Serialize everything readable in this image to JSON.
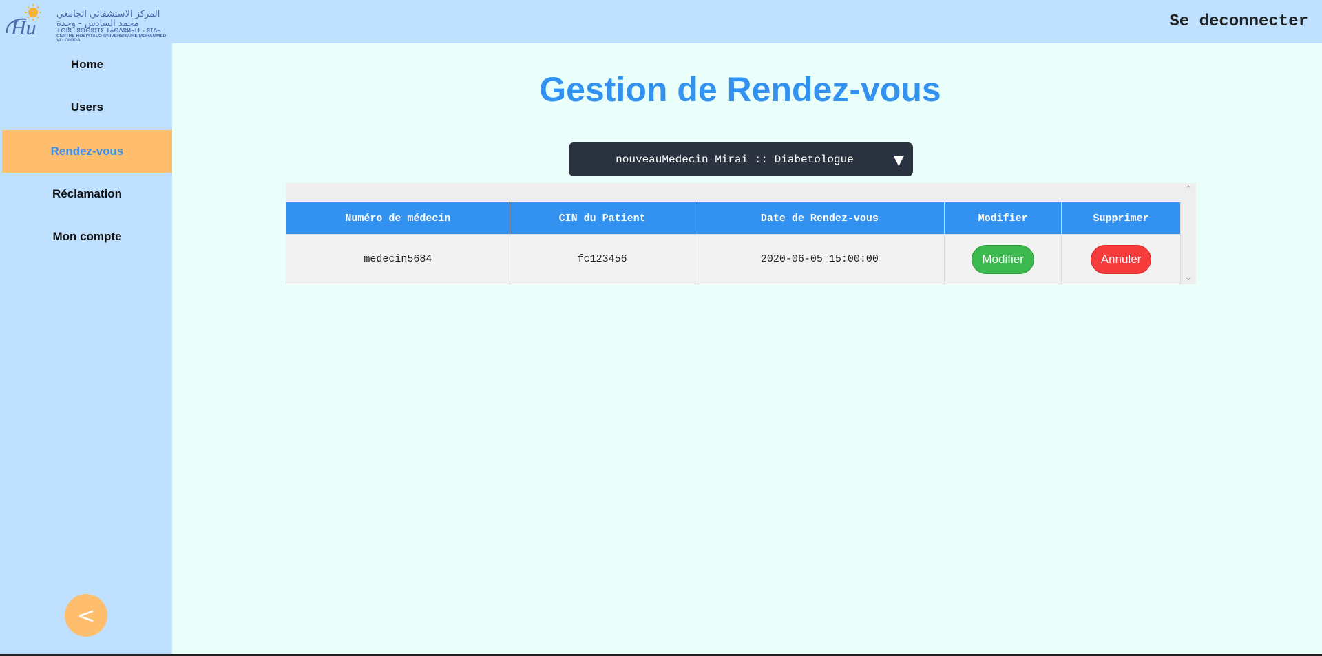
{
  "header": {
    "logo": {
      "arabic_text": "المركز الاستشفائي الجامعي محمد السادس - وجدة",
      "tifinagh_text": "ⵜⵙⵏⵓ ⵏ ⵓⵙⵙⵓⵊⵊⵉ ⵜⴰⵙⴷⵓⵍⴰⵏⵜ - ⵓⵊⴷⴰ",
      "french_text": "CENTRE HOSPITALO-UNIVERSITAIRE MOHAMMED VI - OUJDA",
      "mark": "Hu"
    },
    "logout_label": "Se deconnecter"
  },
  "sidebar": {
    "items": [
      {
        "label": "Home",
        "active": false
      },
      {
        "label": "Users",
        "active": false
      },
      {
        "label": "Rendez-vous",
        "active": true
      },
      {
        "label": "Réclamation",
        "active": false
      },
      {
        "label": "Mon compte",
        "active": false
      }
    ],
    "collapse_label": "<"
  },
  "main": {
    "title": "Gestion de Rendez-vous",
    "doctor_select": {
      "selected": "nouveauMedecin Mirai :: Diabetologue",
      "arrow": "▼"
    },
    "table": {
      "columns": [
        "Numéro de médecin",
        "CIN du Patient",
        "Date de Rendez-vous",
        "Modifier",
        "Supprimer"
      ],
      "rows": [
        {
          "medecin": "medecin5684",
          "cin": "fc123456",
          "date": "2020-06-05 15:00:00",
          "modify_label": "Modifier",
          "delete_label": "Annuler"
        }
      ]
    },
    "scrollbar": {
      "up": "⌃",
      "down": "⌄"
    }
  },
  "colors": {
    "header_bg": "#bfe0ff",
    "main_bg": "#eafff9",
    "accent_blue": "#3391f0",
    "active_orange": "#ffbe6e",
    "select_bg": "#2c3340",
    "btn_green": "#3dba4f",
    "btn_red": "#f53b3b"
  }
}
